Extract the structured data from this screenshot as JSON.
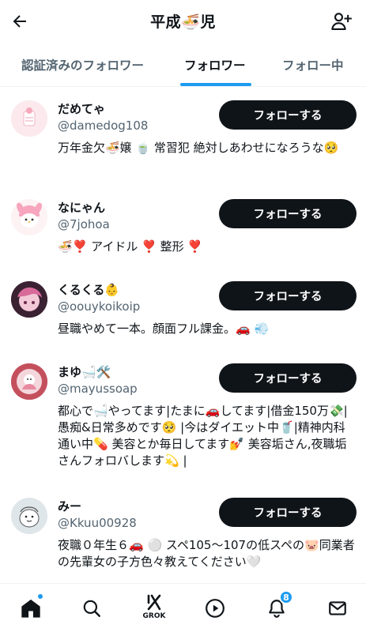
{
  "header": {
    "title": "平成🍜児",
    "back_icon": "arrow-left-icon",
    "add_icon": "person-add-icon"
  },
  "tabs": [
    {
      "label": "認証済みのフォロワー",
      "active": false
    },
    {
      "label": "フォロワー",
      "active": true
    },
    {
      "label": "フォロー中",
      "active": false
    }
  ],
  "users": [
    {
      "name": "だめてゃ",
      "handle": "@damedog108",
      "bio": "万年金欠🍜嬢 🍵 常習犯 絶対しあわせになろうな🥺",
      "button": "フォローする"
    },
    {
      "name": "なにゃん",
      "handle": "@7johoa",
      "bio": "🍜❣️ アイドル ❣️ 整形 ❣️",
      "button": "フォローする"
    },
    {
      "name": "くるくる👶",
      "handle": "@oouykoikoip",
      "bio": "昼職やめて一本。顔面フル課金。🚗 💨",
      "button": "フォローする"
    },
    {
      "name": "まゆ🛁🛠️",
      "handle": "@mayussoap",
      "bio": "都心で🛁やってます|たまに🚗してます|借金150万💸|愚痴&日常多めです🥺 |今はダイエット中🥤|精神内科通い中💊 美容とか毎日してます💅 美容垢さん,夜職垢さんフォロバします💫 |",
      "button": "フォローする"
    },
    {
      "name": "みー",
      "handle": "@Kkuu00928",
      "bio": "夜職０年生６🚗 ⚪️ スペ105〜107の低スペの🐷同業者の先輩女の子方色々教えてください🤍",
      "button": "フォローする"
    }
  ],
  "bottom_nav": {
    "grok_label": "GROK",
    "notification_count": "8",
    "items": [
      "home-icon",
      "search-icon",
      "grok-icon",
      "video-play-icon",
      "bell-icon",
      "mail-icon"
    ]
  },
  "colors": {
    "accent": "#1d9bf0",
    "button_bg": "#0f1419",
    "secondary_text": "#536471"
  }
}
